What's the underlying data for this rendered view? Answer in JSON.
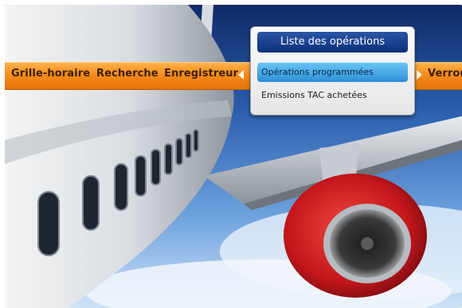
{
  "menu_bar": {
    "items": [
      {
        "label": "Grille-horaire"
      },
      {
        "label": "Recherche"
      },
      {
        "label": "Enregistreur"
      },
      {
        "label": "Verrou"
      }
    ]
  },
  "submenu": {
    "title": "Liste des opérations",
    "items": [
      {
        "label": "Opérations programmées",
        "selected": true
      },
      {
        "label": "Emissions TAC achetées",
        "selected": false
      }
    ]
  },
  "icons": {
    "left_arrow": "left-arrow-icon",
    "right_arrow": "right-arrow-icon"
  },
  "colors": {
    "menu_bar": "#f48c1c",
    "submenu_title": "#0c2f78",
    "selected_item": "#2c8fd6"
  }
}
